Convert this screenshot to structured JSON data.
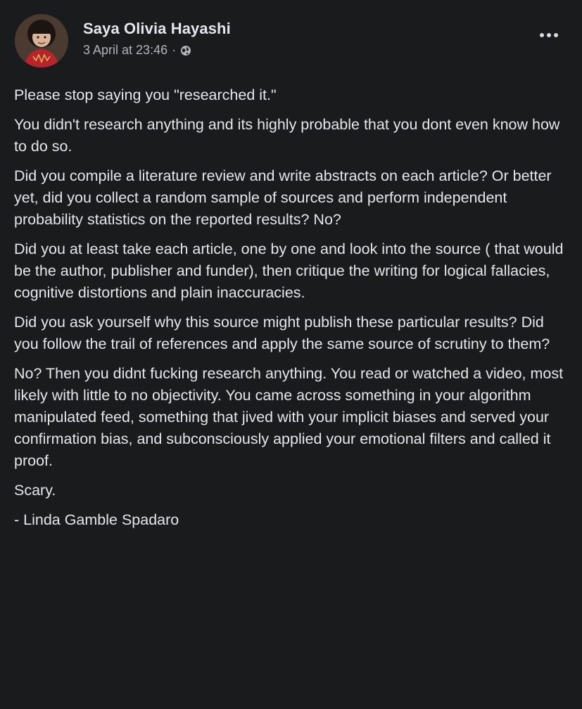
{
  "post": {
    "author": "Saya Olivia Hayashi",
    "timestamp": "3 April at 23:46",
    "separator": "·",
    "privacy_icon": "globe-icon",
    "more_icon": "more-options-icon",
    "paragraphs": [
      "Please stop saying you \"researched it.\"",
      "You didn't research anything and its highly probable that you dont even know how to do so.",
      "Did you compile a literature review and write abstracts on each article? Or better yet, did you collect a random sample of sources and perform independent probability statistics on the reported results? No?",
      "Did you at least take each article, one by one and look into the source ( that would be the author, publisher and funder), then critique the writing for logical fallacies, cognitive distortions and plain inaccuracies.",
      "Did you ask yourself why this source might publish these particular results? Did you follow the trail of references and apply the same source of scrutiny to them?",
      "No? Then you didnt fucking research anything. You read or watched a video, most likely with little to no objectivity. You came across something in your algorithm manipulated feed, something that jived with your implicit biases and served your confirmation bias, and subconsciously applied your emotional filters and called it proof.",
      "Scary.",
      "- Linda Gamble Spadaro"
    ]
  },
  "colors": {
    "background": "#1a1b1c",
    "primary_text": "#e4e6eb",
    "secondary_text": "#b0b3b8"
  }
}
